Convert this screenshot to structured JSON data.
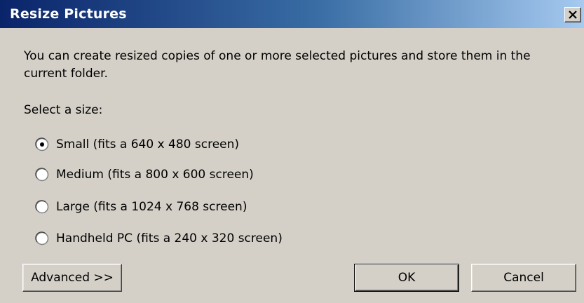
{
  "window": {
    "title": "Resize Pictures",
    "close_icon": "close-icon"
  },
  "description": "You can create resized copies of one or more selected pictures and store them in the current folder.",
  "size_prompt": "Select a size:",
  "size_options": [
    {
      "label": "Small (fits a 640 x 480 screen)",
      "selected": true
    },
    {
      "label": "Medium (fits a 800 x 600 screen)",
      "selected": false
    },
    {
      "label": "Large (fits a 1024 x 768 screen)",
      "selected": false
    },
    {
      "label": "Handheld PC (fits a 240 x 320 screen)",
      "selected": false
    }
  ],
  "buttons": {
    "advanced": "Advanced >>",
    "ok": "OK",
    "cancel": "Cancel"
  },
  "colors": {
    "titlebar_start": "#0a246a",
    "titlebar_end": "#a6caf0",
    "face": "#d4d0c8"
  }
}
